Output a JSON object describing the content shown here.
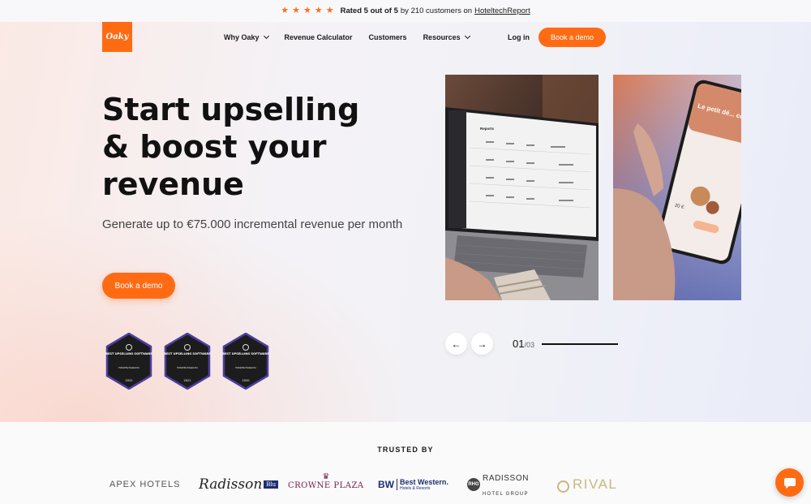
{
  "colors": {
    "accent": "#ff6b13",
    "text": "#111111",
    "badge_bg": "#1c1c1c",
    "badge_border": "#4b3f9e"
  },
  "topbar": {
    "rating_bold": "Rated 5 out of 5",
    "rating_mid": "by 210 customers on",
    "rating_link": "HoteltechReport",
    "star_count": 5
  },
  "nav": {
    "logo": "Oaky",
    "items": [
      {
        "label": "Why Oaky",
        "has_dropdown": true
      },
      {
        "label": "Revenue Calculator",
        "has_dropdown": false
      },
      {
        "label": "Customers",
        "has_dropdown": false
      },
      {
        "label": "Resources",
        "has_dropdown": true
      }
    ],
    "login": "Log in",
    "cta": "Book a demo"
  },
  "hero": {
    "headline_1": "Start upselling",
    "headline_2": "& boost your",
    "headline_3": "revenue",
    "subheadline": "Generate up to €75.000 incremental revenue per month",
    "cta": "Book a demo"
  },
  "badges": [
    {
      "title": "BEST UPSELLING SOFTWARE",
      "org": "HotelTechAwards",
      "year": "2022"
    },
    {
      "title": "BEST UPSELLING SOFTWARE",
      "org": "HotelTechAwards",
      "year": "2021"
    },
    {
      "title": "BEST UPSELLING SOFTWARE",
      "org": "HotelTechAwards",
      "year": "2020"
    }
  ],
  "carousel": {
    "current": "01",
    "total": "/03",
    "progress": 0.33,
    "slide1_screen_title": "Reports",
    "slide2_phone_text": "Le petit dé... coure de...",
    "slide2_price": "20 €"
  },
  "trusted": {
    "title": "TRUSTED BY",
    "logos": {
      "apex": "APEX HOTELS",
      "radisson": "Radisson",
      "radisson_blu": "Blu",
      "crowne": "CROWNE PLAZA",
      "bw_mark": "BW",
      "bw_name": "Best Western.",
      "bw_sub": "Hotels & Resorts",
      "rhg_mark": "RHG",
      "rhg_name": "RADISSON",
      "rhg_sub": "HOTEL GROUP",
      "rival": "RIVAL"
    }
  },
  "icons": {
    "star": "star-icon",
    "arrow_left": "arrow-left-icon",
    "arrow_right": "arrow-right-icon",
    "chat": "chat-bubble-icon"
  }
}
